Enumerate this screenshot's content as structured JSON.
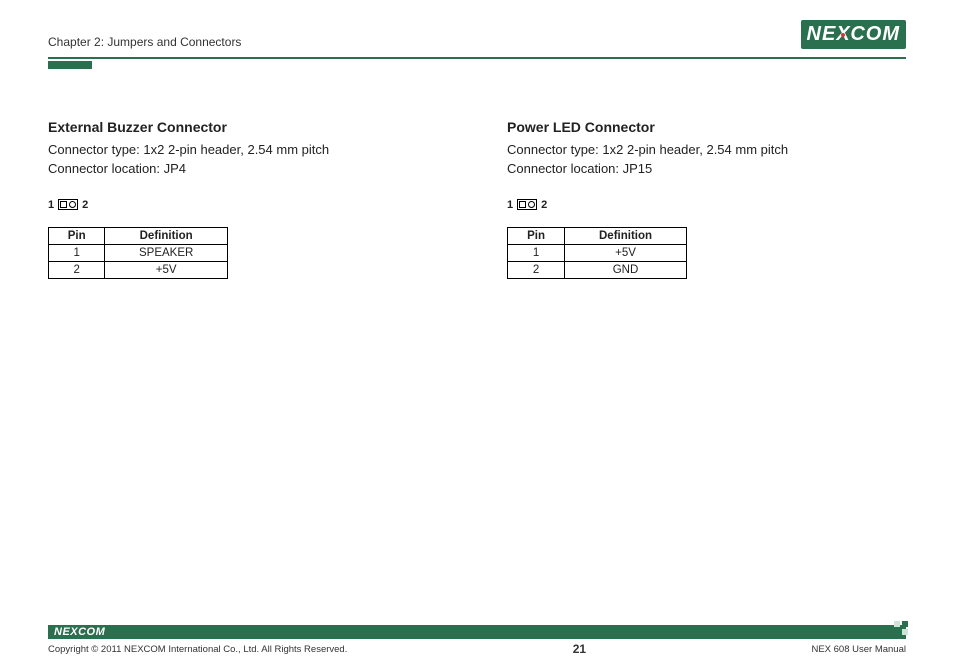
{
  "header": {
    "chapter": "Chapter 2: Jumpers and Connectors",
    "logo_ne": "NE",
    "logo_x": "X",
    "logo_com": "COM"
  },
  "sections": {
    "left": {
      "title": "External Buzzer Connector",
      "line1": "Connector type: 1x2 2-pin header, 2.54 mm pitch",
      "line2": "Connector location: JP4",
      "pin_left": "1",
      "pin_right": "2",
      "th_pin": "Pin",
      "th_def": "Definition",
      "rows": [
        {
          "pin": "1",
          "def": "SPEAKER"
        },
        {
          "pin": "2",
          "def": "+5V"
        }
      ]
    },
    "right": {
      "title": "Power LED Connector",
      "line1": "Connector type: 1x2 2-pin header, 2.54 mm pitch",
      "line2": "Connector location: JP15",
      "pin_left": "1",
      "pin_right": "2",
      "th_pin": "Pin",
      "th_def": "Definition",
      "rows": [
        {
          "pin": "1",
          "def": "+5V"
        },
        {
          "pin": "2",
          "def": "GND"
        }
      ]
    }
  },
  "footer": {
    "logo": "NEXCOM",
    "copyright": "Copyright © 2011 NEXCOM International Co., Ltd. All Rights Reserved.",
    "page": "21",
    "doc": "NEX 608 User Manual"
  }
}
